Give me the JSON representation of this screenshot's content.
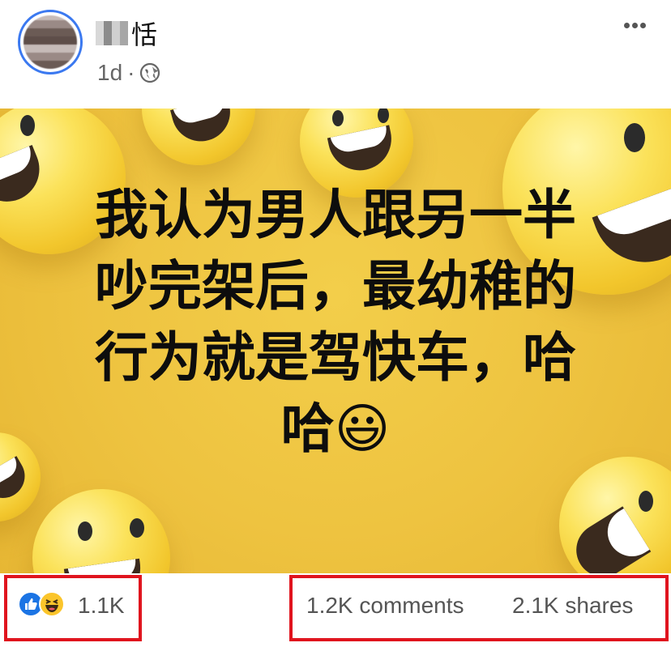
{
  "post": {
    "author_name_visible": "恬",
    "timestamp": "1d",
    "separator": "·",
    "audience_icon": "globe-icon",
    "more_icon": "more-options-icon",
    "text_lines": [
      "我认为男人跟另一半",
      "吵完架后，最幼稚的",
      "行为就是驾快车，哈",
      "哈😃"
    ]
  },
  "footer": {
    "reaction_icons": [
      "like-icon",
      "haha-icon"
    ],
    "reaction_count": "1.1K",
    "comments": "1.2K comments",
    "shares": "2.1K shares"
  },
  "colors": {
    "accent_blue": "#1b74e4",
    "highlight_red": "#e0141e",
    "background_yellow": "#eec340"
  }
}
